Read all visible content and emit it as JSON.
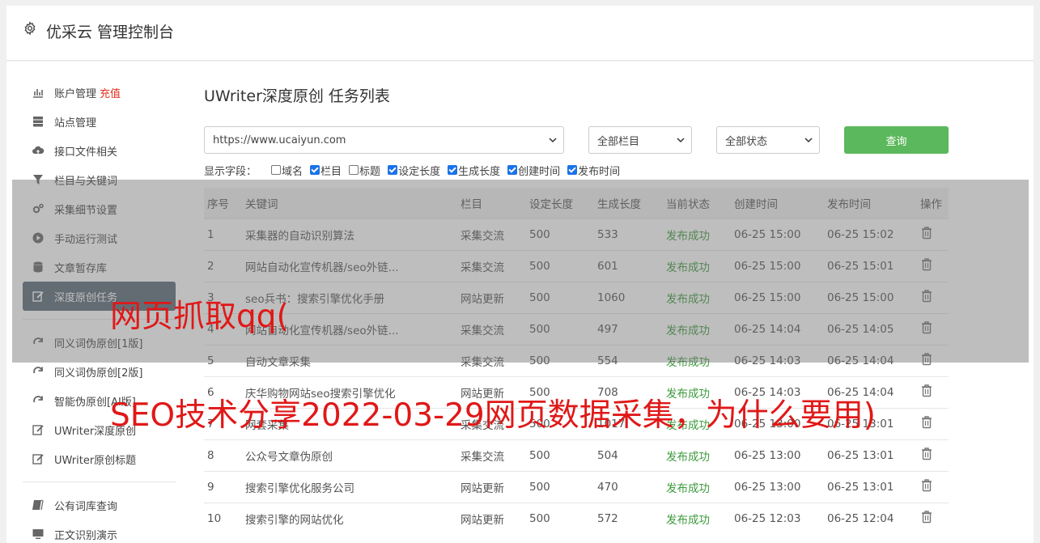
{
  "app": {
    "title": "优采云 管理控制台"
  },
  "sidebar": {
    "items": [
      {
        "label": "账户管理",
        "badge": "充值",
        "icon": "bar-chart-icon"
      },
      {
        "label": "站点管理",
        "icon": "server-icon"
      },
      {
        "label": "接口文件相关",
        "icon": "cloud-upload-icon"
      },
      {
        "label": "栏目与关键词",
        "icon": "filter-icon"
      },
      {
        "label": "采集细节设置",
        "icon": "gears-icon"
      },
      {
        "label": "手动运行测试",
        "icon": "play-icon"
      },
      {
        "label": "文章暂存库",
        "icon": "database-icon"
      },
      {
        "label": "深度原创任务",
        "icon": "edit-icon"
      }
    ],
    "items2": [
      {
        "label": "同义词伪原创[1版]",
        "icon": "refresh-icon"
      },
      {
        "label": "同义词伪原创[2版]",
        "icon": "refresh-icon"
      },
      {
        "label": "智能伪原创[AI版]",
        "icon": "refresh-icon"
      },
      {
        "label": "UWriter深度原创",
        "icon": "edit-icon"
      },
      {
        "label": "UWriter原创标题",
        "icon": "edit-icon"
      }
    ],
    "items3": [
      {
        "label": "公有词库查询",
        "icon": "book-icon"
      },
      {
        "label": "正文识别演示",
        "icon": "monitor-icon"
      }
    ]
  },
  "main": {
    "title": "UWriter深度原创 任务列表",
    "site_select": "https://www.ucaiyun.com",
    "column_select": "全部栏目",
    "status_select": "全部状态",
    "search_label": "查询",
    "fields_label": "显示字段：",
    "fields": [
      {
        "label": "域名",
        "checked": false
      },
      {
        "label": "栏目",
        "checked": true
      },
      {
        "label": "标题",
        "checked": false
      },
      {
        "label": "设定长度",
        "checked": true
      },
      {
        "label": "生成长度",
        "checked": true
      },
      {
        "label": "创建时间",
        "checked": true
      },
      {
        "label": "发布时间",
        "checked": true
      }
    ]
  },
  "table": {
    "headers": [
      "序号",
      "关键词",
      "栏目",
      "设定长度",
      "生成长度",
      "当前状态",
      "创建时间",
      "发布时间",
      "操作"
    ],
    "rows": [
      [
        "1",
        "采集器的自动识别算法",
        "采集交流",
        "500",
        "533",
        "发布成功",
        "06-25 15:00",
        "06-25 15:02"
      ],
      [
        "2",
        "网站自动化宣传机器/seo外链...",
        "采集交流",
        "500",
        "601",
        "发布成功",
        "06-25 15:00",
        "06-25 15:01"
      ],
      [
        "3",
        "seo兵书：搜索引擎优化手册",
        "网站更新",
        "500",
        "1060",
        "发布成功",
        "06-25 15:00",
        "06-25 15:00"
      ],
      [
        "4",
        "网站自动化宣传机器/seo外链...",
        "采集交流",
        "500",
        "497",
        "发布成功",
        "06-25 14:04",
        "06-25 14:05"
      ],
      [
        "5",
        "自动文章采集",
        "采集交流",
        "500",
        "554",
        "发布成功",
        "06-25 14:03",
        "06-25 14:04"
      ],
      [
        "6",
        "庆华购物网站seo搜索引擎优化",
        "网站更新",
        "500",
        "708",
        "发布成功",
        "06-25 14:03",
        "06-25 14:04"
      ],
      [
        "7",
        "网套采集",
        "采集交流",
        "500",
        "1017",
        "发布成功",
        "06-25 13:00",
        "06-25 13:01"
      ],
      [
        "8",
        "公众号文章伪原创",
        "采集交流",
        "500",
        "504",
        "发布成功",
        "06-25 13:00",
        "06-25 13:01"
      ],
      [
        "9",
        "搜索引擎优化服务公司",
        "网站更新",
        "500",
        "470",
        "发布成功",
        "06-25 13:00",
        "06-25 13:01"
      ],
      [
        "10",
        "搜索引擎的网站优化",
        "网站更新",
        "500",
        "572",
        "发布成功",
        "06-25 12:03",
        "06-25 12:04"
      ]
    ]
  },
  "watermark": {
    "line1": "网页抓取qq(",
    "line2": "SEO技术分享2022-03-29网页数据采集，为什么要用)"
  },
  "colors": {
    "accent_green": "#5cb85c",
    "active_sidebar": "#5a6877",
    "status_ok": "#3c9a3c",
    "watermark": "#e01818"
  }
}
